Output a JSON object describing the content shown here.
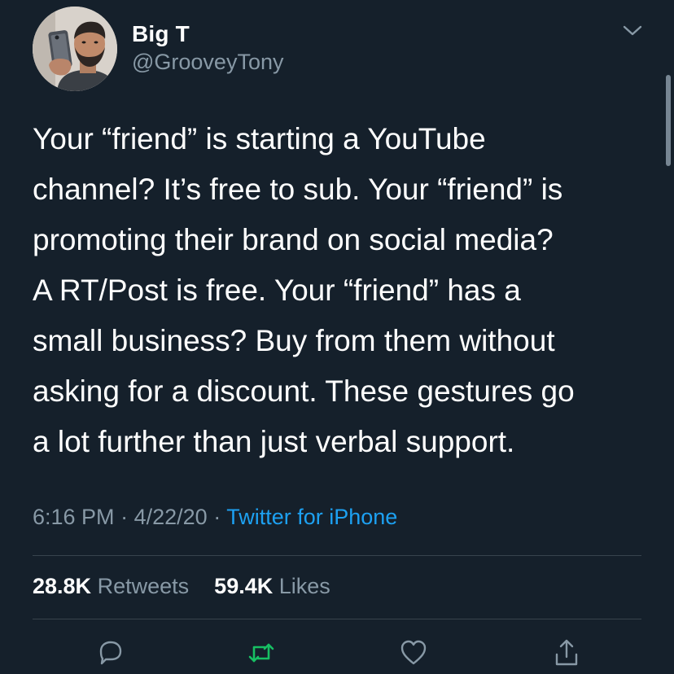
{
  "user": {
    "display_name": "Big T",
    "handle": "@GrooveyTony",
    "avatar_icon": "profile-photo-selfie"
  },
  "tweet": {
    "text_lines": [
      "Your “friend” is starting a YouTube",
      "channel? It’s free to sub. Your “friend” is",
      "promoting their brand on social media?",
      "A RT/Post is free. Your “friend” has a",
      "small business? Buy from them without",
      "asking for a discount. These gestures go",
      "a lot further than just verbal support."
    ],
    "time": "6:16 PM",
    "date": "4/22/20",
    "separator": "·",
    "source": "Twitter for iPhone"
  },
  "stats": {
    "retweets_count": "28.8K",
    "retweets_label": "Retweets",
    "likes_count": "59.4K",
    "likes_label": "Likes"
  },
  "actions": {
    "reply_icon": "comment-icon",
    "retweet_icon": "retweet-icon",
    "like_icon": "heart-icon",
    "share_icon": "share-icon"
  },
  "colors": {
    "background": "#15202b",
    "text_primary": "#ffffff",
    "text_secondary": "#8899a6",
    "link": "#1da1f2",
    "retweet_green": "#17bf63",
    "divider": "#38444d"
  }
}
